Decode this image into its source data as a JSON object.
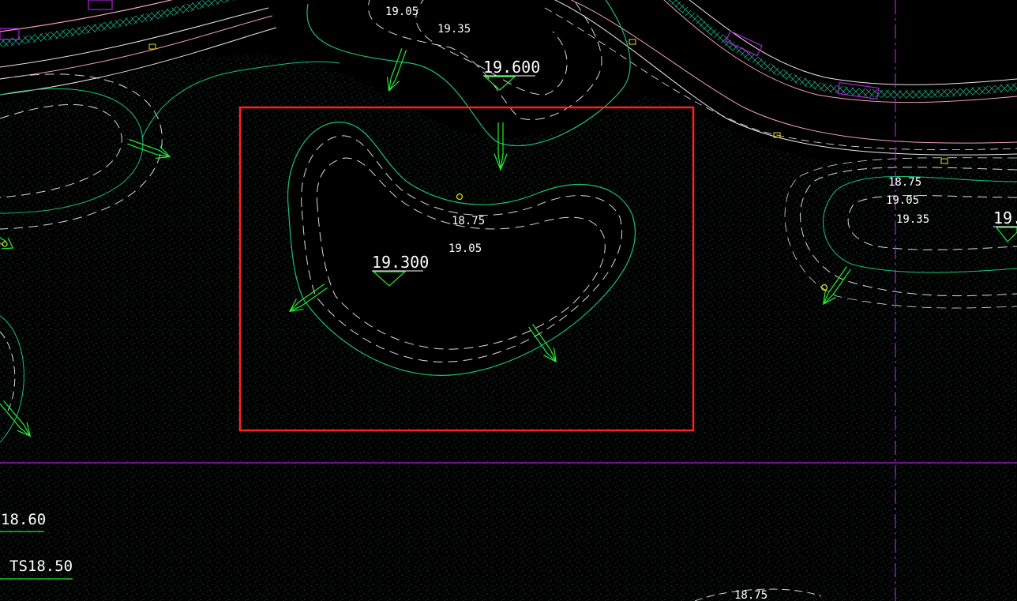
{
  "drawing": {
    "background": "#000000",
    "colors": {
      "hatch": "#1f7a5a",
      "contour_solid": "#17c27a",
      "contour_dashed": "#d8d8d8",
      "arrow": "#22ee33",
      "selection": "#ff2020",
      "grid_line": "#b020d8",
      "road_edge_pink": "#f0a0b8",
      "road_edge_white": "#e8e8e8",
      "road_hatch": "#1aa080",
      "marker_yellow": "#e8e020",
      "text": "#ffffff"
    },
    "contour_labels": [
      {
        "id": "top-1905",
        "text": "19.05"
      },
      {
        "id": "top-1935",
        "text": "19.35"
      },
      {
        "id": "pond-1875",
        "text": "18.75"
      },
      {
        "id": "pond-1905",
        "text": "19.05"
      },
      {
        "id": "right-1875",
        "text": "18.75"
      },
      {
        "id": "right-1905",
        "text": "19.05"
      },
      {
        "id": "right-1935",
        "text": "19.35"
      },
      {
        "id": "bottom-1875",
        "text": "18.75"
      }
    ],
    "elevation_marks": [
      {
        "id": "top-peak",
        "text": "19.600"
      },
      {
        "id": "pond-peak",
        "text": "19.300"
      },
      {
        "id": "right-peak",
        "text": "19."
      }
    ],
    "level_labels": [
      {
        "id": "level-1860",
        "text": "18.60"
      },
      {
        "id": "level-ts1850",
        "text": "TS18.50"
      }
    ]
  }
}
